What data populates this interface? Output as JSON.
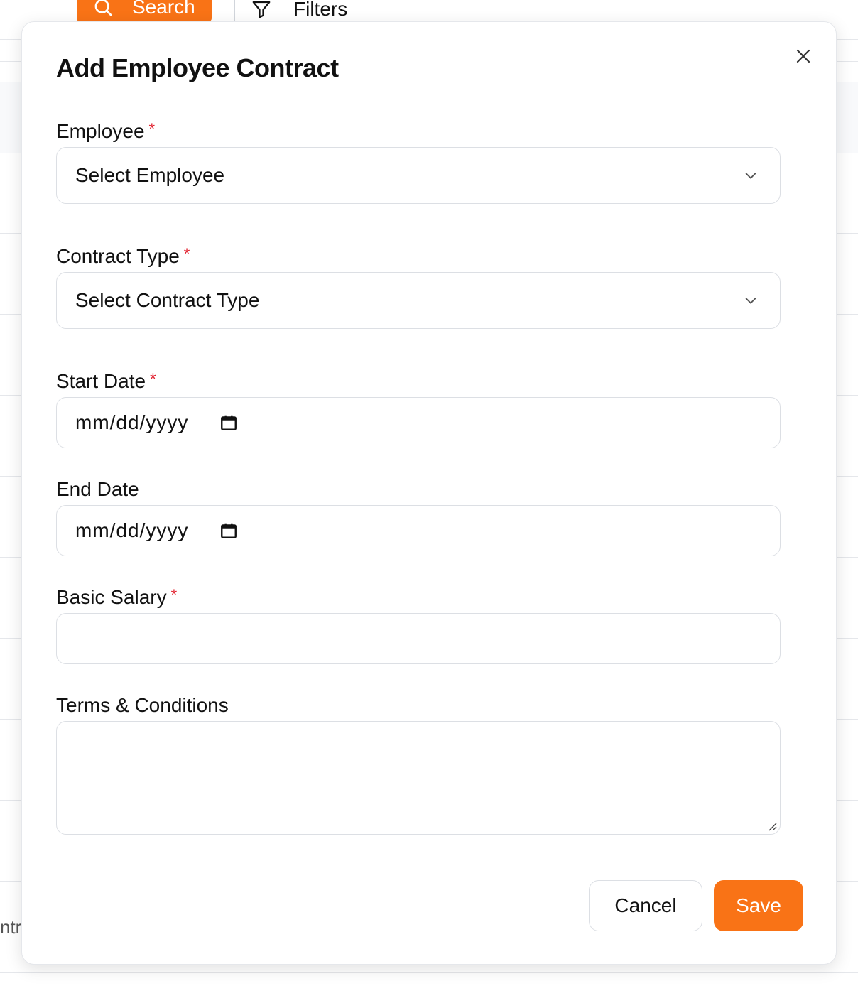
{
  "background": {
    "search_label": "Search",
    "filters_label": "Filters",
    "row_fragment": "ntra"
  },
  "modal": {
    "title": "Add Employee Contract",
    "required_mark": "*",
    "fields": {
      "employee": {
        "label": "Employee",
        "placeholder": "Select Employee"
      },
      "contract_type": {
        "label": "Contract Type",
        "placeholder": "Select Contract Type"
      },
      "start_date": {
        "label": "Start Date",
        "placeholder": "mm/dd/yyyy"
      },
      "end_date": {
        "label": "End Date",
        "placeholder": "mm/dd/yyyy"
      },
      "basic_salary": {
        "label": "Basic Salary",
        "value": ""
      },
      "terms": {
        "label": "Terms & Conditions",
        "value": ""
      }
    },
    "buttons": {
      "cancel": "Cancel",
      "save": "Save"
    }
  },
  "icons": {
    "close": "close-icon",
    "chevron": "chevron-down-icon",
    "calendar": "calendar-icon",
    "search": "search-icon",
    "filter": "filter-icon"
  },
  "colors": {
    "accent": "#f97316",
    "required": "#e11d2b",
    "border": "#dcdfe4"
  }
}
